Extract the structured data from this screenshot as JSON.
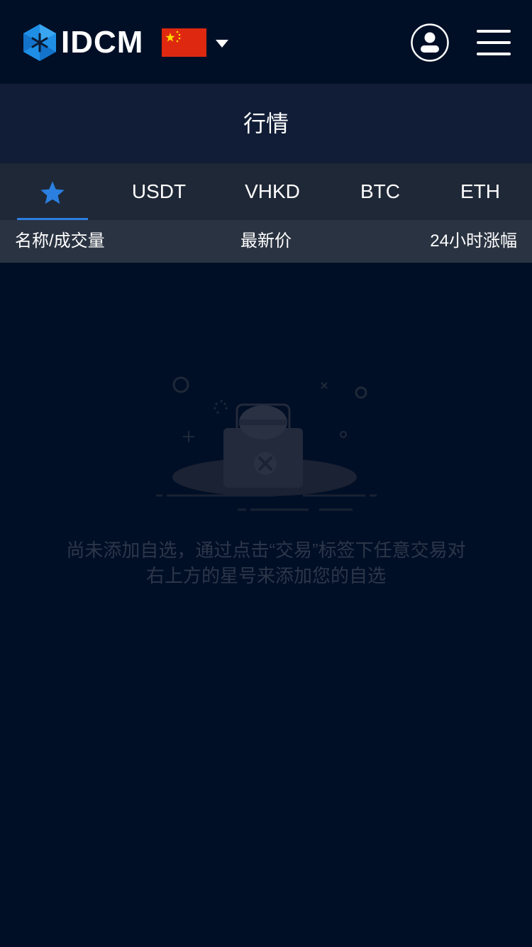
{
  "header": {
    "logo_text": "IDCM",
    "language_flag": "china-flag",
    "icons": [
      "logo-icon",
      "chevron-down-icon",
      "user-icon",
      "menu-icon"
    ]
  },
  "page": {
    "title": "行情"
  },
  "tabs": {
    "favorites_icon": "star-icon",
    "items": [
      "USDT",
      "VHKD",
      "BTC",
      "ETH"
    ],
    "active": "favorites"
  },
  "columns": {
    "name": "名称/成交量",
    "price": "最新价",
    "change": "24小时涨幅"
  },
  "empty": {
    "line1": "尚未添加自选，通过点击“交易”标签下任意交易对",
    "line2": "右上方的星号来添加您的自选"
  },
  "colors": {
    "background": "#000f26",
    "title_bar": "#111d36",
    "tab_bar": "#1f2837",
    "column_header": "#2a3341",
    "accent": "#2b7fe0",
    "muted_text": "#2d3649"
  }
}
